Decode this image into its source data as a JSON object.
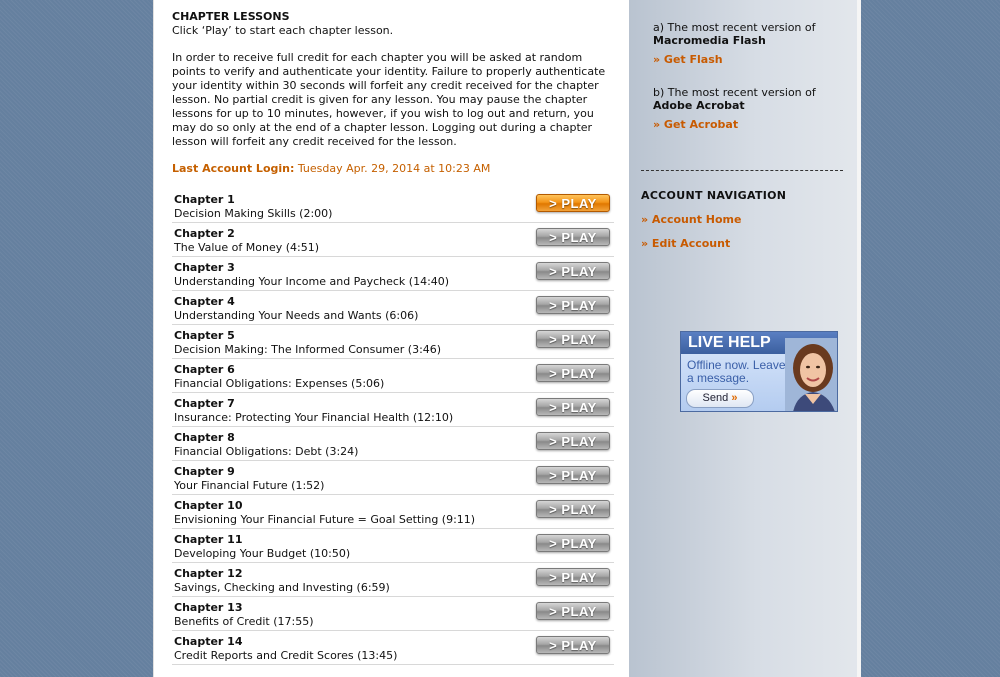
{
  "main": {
    "heading": "CHAPTER LESSONS",
    "intro": "Click ‘Play’ to start each chapter lesson.",
    "paragraph": "In order to receive full credit for each chapter you will be asked at random points to verify and authenticate your identity. Failure to properly authenticate your identity within 30 seconds will forfeit any credit received for the chapter lesson. No partial credit is given for any lesson. You may pause the chapter lessons for up to 10 minutes, however, if you wish to log out and return, you may do so only at the end of a chapter lesson. Logging out during a chapter lesson will forfeit any credit received for the lesson.",
    "last_login_label": "Last Account Login:",
    "last_login_value": "Tuesday Apr. 29, 2014 at 10:23 AM",
    "play_label": "> PLAY",
    "chapters": [
      {
        "num": "Chapter 1",
        "title": "Decision Making Skills (2:00)"
      },
      {
        "num": "Chapter 2",
        "title": "The Value of Money (4:51)"
      },
      {
        "num": "Chapter 3",
        "title": "Understanding Your Income and Paycheck (14:40)"
      },
      {
        "num": "Chapter 4",
        "title": "Understanding Your Needs and Wants (6:06)"
      },
      {
        "num": "Chapter 5",
        "title": "Decision Making: The Informed Consumer (3:46)"
      },
      {
        "num": "Chapter 6",
        "title": "Financial Obligations: Expenses (5:06)"
      },
      {
        "num": "Chapter 7",
        "title": "Insurance: Protecting Your Financial Health (12:10)"
      },
      {
        "num": "Chapter 8",
        "title": "Financial Obligations: Debt (3:24)"
      },
      {
        "num": "Chapter 9",
        "title": "Your Financial Future (1:52)"
      },
      {
        "num": "Chapter 10",
        "title": "Envisioning Your Financial Future = Goal Setting (9:11)"
      },
      {
        "num": "Chapter 11",
        "title": "Developing Your Budget (10:50)"
      },
      {
        "num": "Chapter 12",
        "title": "Savings, Checking and Investing (6:59)"
      },
      {
        "num": "Chapter 13",
        "title": "Benefits of Credit (17:55)"
      },
      {
        "num": "Chapter 14",
        "title": "Credit Reports and Credit Scores (13:45)"
      }
    ]
  },
  "sidebar": {
    "req_a_prefix": "a) The most recent version of",
    "req_a_name": "Macromedia Flash",
    "req_a_link": "» Get Flash",
    "req_b_prefix": "b) The most recent version of",
    "req_b_name": "Adobe Acrobat",
    "req_b_link": "» Get Acrobat",
    "nav_heading": "ACCOUNT NAVIGATION",
    "nav_home": "» Account Home",
    "nav_edit": "» Edit Account",
    "live_help_title": "LIVE HELP",
    "live_help_status": "Offline now. Leave a message.",
    "live_help_send": "Send",
    "live_help_arrows": "»"
  },
  "colors": {
    "background": "#65809f",
    "accent_orange": "#c85a00",
    "play_active": "#f4951a",
    "play_inactive": "#a6a6a6",
    "live_help_blue": "#3b5f9f"
  }
}
